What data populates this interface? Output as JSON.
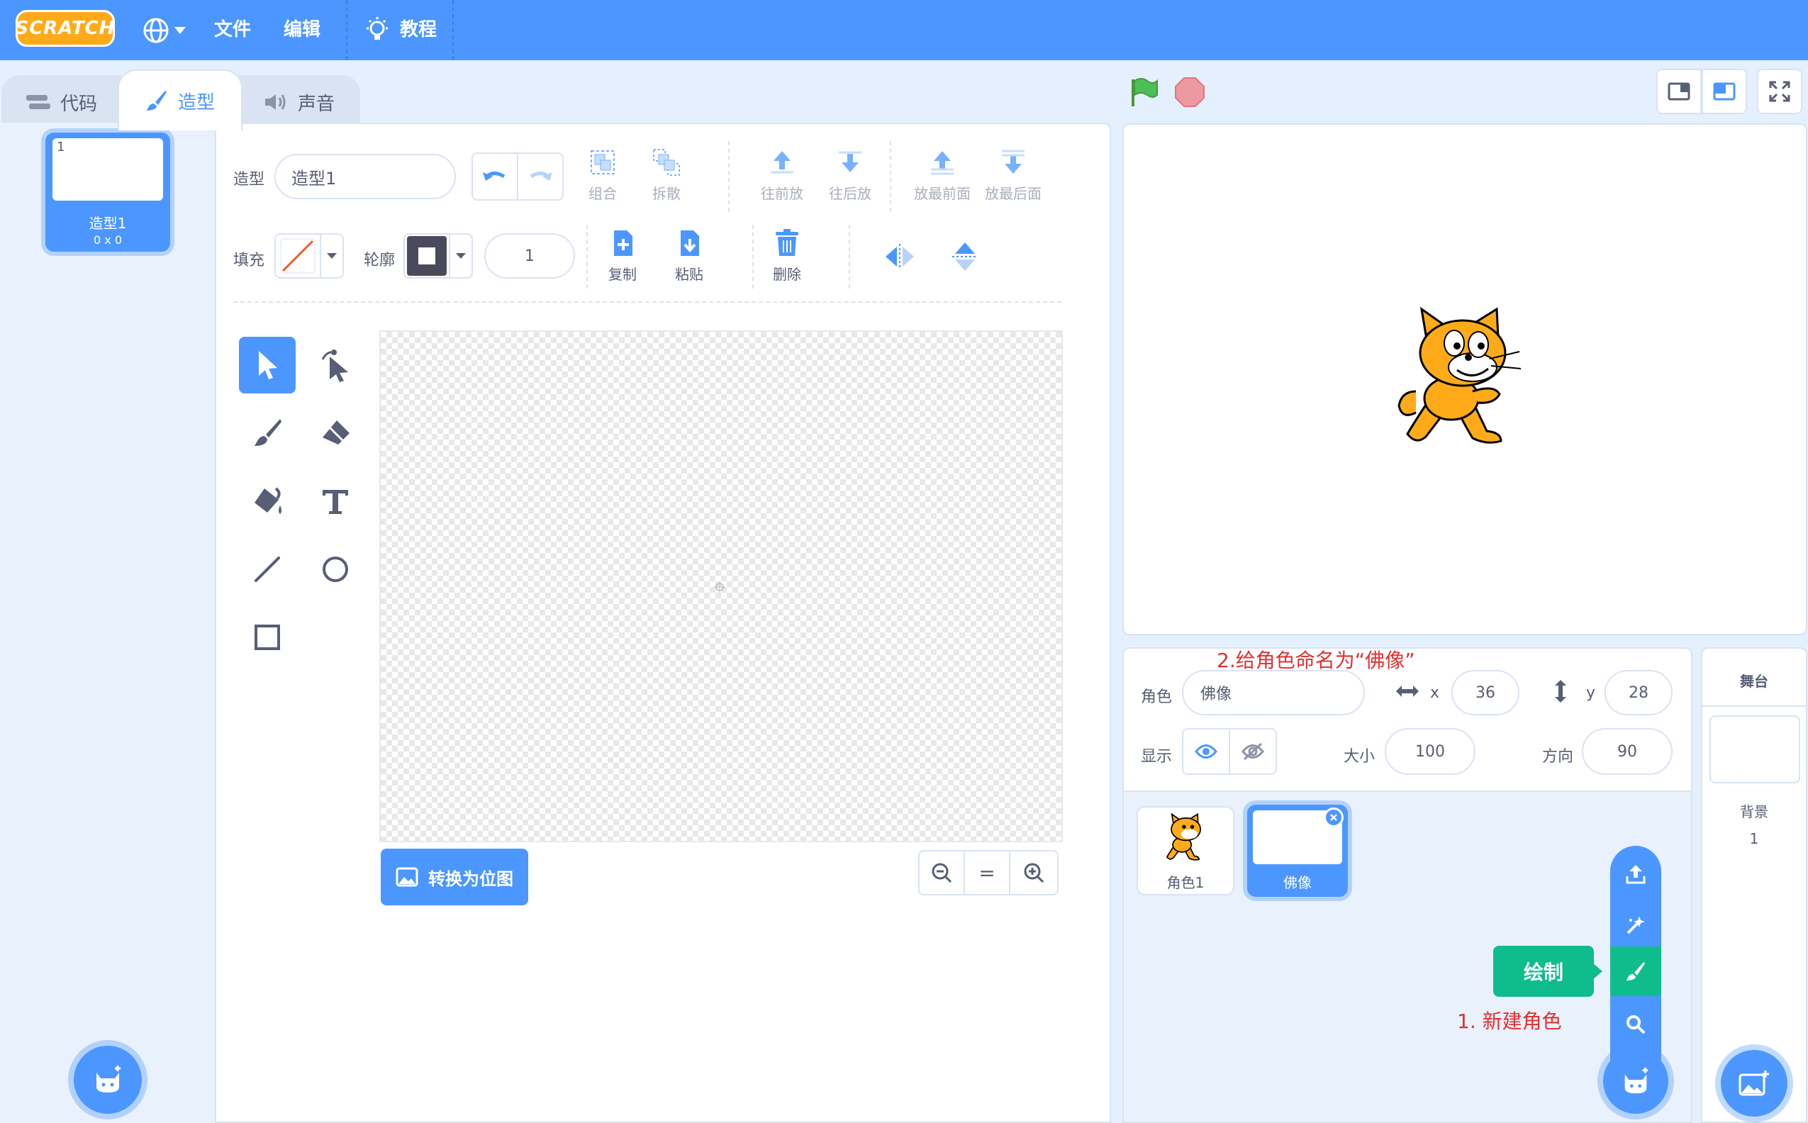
{
  "menubar": {
    "logo": "SCRATCH",
    "file": "文件",
    "edit": "编辑",
    "tutorials": "教程",
    "colors": {
      "bar": "#4c97ff"
    }
  },
  "tabs": [
    {
      "label": "代码",
      "icon": "code-icon"
    },
    {
      "label": "造型",
      "icon": "paintbrush-icon",
      "active": true
    },
    {
      "label": "声音",
      "icon": "speaker-icon"
    }
  ],
  "costume_list": {
    "items": [
      {
        "index": "1",
        "name": "造型1",
        "size": "0 x 0"
      }
    ]
  },
  "paint_editor": {
    "costume_label": "造型",
    "costume_name": "造型1",
    "fill_label": "填充",
    "outline_label": "轮廓",
    "outline_width": "1",
    "buttons": {
      "group": "组合",
      "ungroup": "拆散",
      "forward": "往前放",
      "backward": "往后放",
      "front": "放最前面",
      "back": "放最后面",
      "copy": "复制",
      "paste": "粘贴",
      "delete": "删除"
    },
    "convert_button": "转换为位图",
    "zoom_reset": "="
  },
  "sprite_info": {
    "sprite_label": "角色",
    "sprite_name": "佛像",
    "x_label": "x",
    "x_value": "36",
    "y_label": "y",
    "y_value": "28",
    "show_label": "显示",
    "size_label": "大小",
    "size_value": "100",
    "direction_label": "方向",
    "direction_value": "90"
  },
  "sprites": [
    {
      "name": "角色1"
    },
    {
      "name": "佛像",
      "selected": true
    }
  ],
  "stage_pane": {
    "title": "舞台",
    "backdrop_label": "背景",
    "backdrop_count": "1"
  },
  "paint_tooltip": "绘制",
  "annotations": {
    "step1": "1. 新建角色",
    "step2": "2.给角色命名为“佛像”"
  }
}
